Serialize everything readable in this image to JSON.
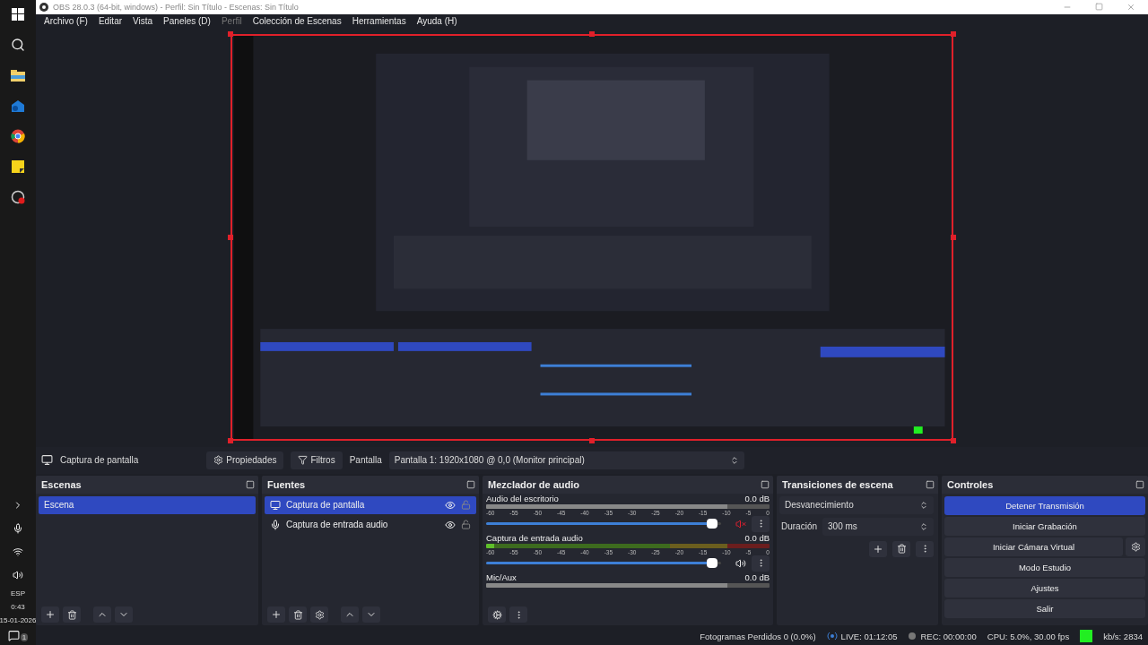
{
  "taskbar": {
    "language": "ESP",
    "time": "0:43",
    "date": "15-01-2026",
    "notifications": "1"
  },
  "window": {
    "title": "OBS 28.0.3 (64-bit, windows) - Perfil: Sin Título - Escenas: Sin Título"
  },
  "menu": [
    {
      "label": "Archivo (F)",
      "disabled": false
    },
    {
      "label": "Editar",
      "disabled": false
    },
    {
      "label": "Vista",
      "disabled": false
    },
    {
      "label": "Paneles (D)",
      "disabled": false
    },
    {
      "label": "Perfil",
      "disabled": true
    },
    {
      "label": "Colección de Escenas",
      "disabled": false
    },
    {
      "label": "Herramientas",
      "disabled": false
    },
    {
      "label": "Ayuda (H)",
      "disabled": false
    }
  ],
  "preview": {
    "kind": "picture",
    "source_selected": true
  },
  "source_toolbar": {
    "source": "Captura de pantalla",
    "properties": "Propiedades",
    "filters": "Filtros",
    "display_label": "Pantalla",
    "display_value": "Pantalla 1: 1920x1080 @ 0,0 (Monitor principal)"
  },
  "scenes": {
    "title": "Escenas",
    "items": [
      {
        "label": "Escena",
        "selected": true
      }
    ]
  },
  "sources": {
    "title": "Fuentes",
    "items": [
      {
        "label": "Captura de pantalla",
        "kind": "display",
        "selected": true,
        "visible": true,
        "locked": false
      },
      {
        "label": "Captura de entrada audio",
        "kind": "mic",
        "selected": false,
        "visible": true,
        "locked": false
      }
    ]
  },
  "mixer": {
    "title": "Mezclador de audio",
    "channels": [
      {
        "name": "Audio del escritorio",
        "reading": "0.0 dB",
        "muted": true,
        "level": 0.96,
        "ticks": [
          "-60",
          "-55",
          "-50",
          "-45",
          "-40",
          "-35",
          "-30",
          "-25",
          "-20",
          "-15",
          "-10",
          "-5",
          "0"
        ]
      },
      {
        "name": "Captura de entrada audio",
        "reading": "0.0 dB",
        "muted": false,
        "level": 0.96,
        "ticks": [
          "-60",
          "-55",
          "-50",
          "-45",
          "-40",
          "-35",
          "-30",
          "-25",
          "-20",
          "-15",
          "-10",
          "-5",
          "0"
        ]
      },
      {
        "name": "Mic/Aux",
        "reading": "0.0 dB"
      }
    ]
  },
  "transitions": {
    "title": "Transiciones de escena",
    "transition": "Desvanecimiento",
    "duration_label": "Duración",
    "duration": "300 ms"
  },
  "controls": {
    "title": "Controles",
    "buttons": [
      {
        "label": "Detener Transmisión",
        "active": true,
        "kind": "plain"
      },
      {
        "label": "Iniciar Grabación",
        "active": false,
        "kind": "plain"
      },
      {
        "label": "Iniciar Cámara Virtual",
        "active": false,
        "kind": "with-settings"
      },
      {
        "label": "Modo Estudio",
        "active": false,
        "kind": "plain"
      },
      {
        "label": "Ajustes",
        "active": false,
        "kind": "plain"
      },
      {
        "label": "Salir",
        "active": false,
        "kind": "plain"
      }
    ]
  },
  "status_bar": {
    "dropped": "Fotogramas Perdidos 0 (0.0%)",
    "live": "LIVE: 01:12:05",
    "rec": "REC: 00:00:00",
    "cpu": "CPU: 5.0%, 30.00 fps",
    "bitrate": "kb/s: 2834"
  }
}
